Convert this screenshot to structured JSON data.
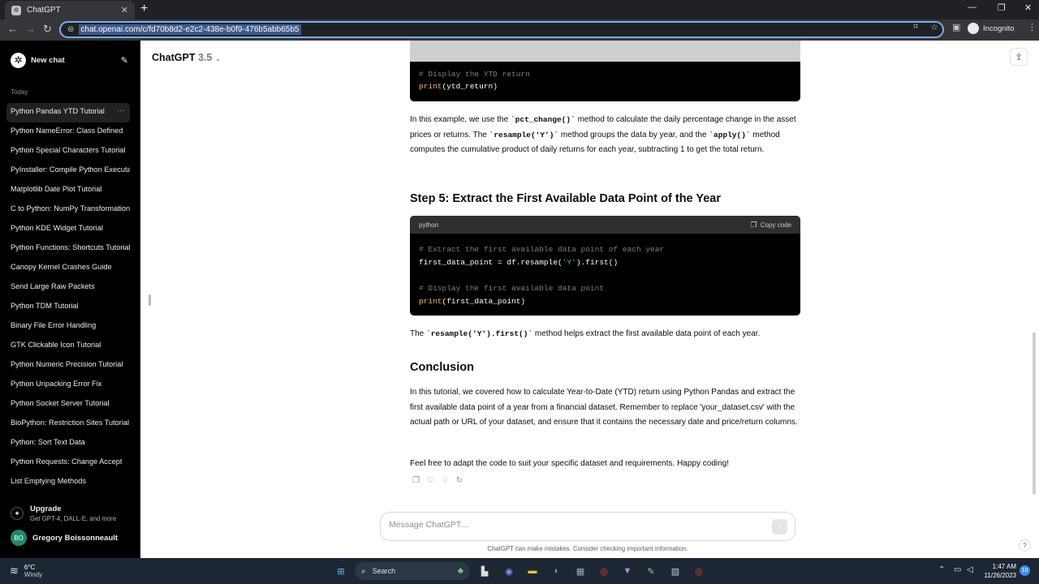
{
  "browser": {
    "tab_title": "ChatGPT",
    "url": "chat.openai.com/c/fd70b8d2-e2c2-438e-b0f9-476b5abb65b5",
    "profile_label": "Incognito"
  },
  "sidebar": {
    "new_chat": "New chat",
    "section_today": "Today",
    "items": [
      {
        "label": "Python Pandas YTD Tutorial",
        "active": true
      },
      {
        "label": "Python NameError: Class Defined"
      },
      {
        "label": "Python Special Characters Tutorial"
      },
      {
        "label": "PyInstaller: Compile Python Executable"
      },
      {
        "label": "Matplotlib Date Plot Tutorial"
      },
      {
        "label": "C to Python: NumPy Transformation"
      },
      {
        "label": "Python KDE Widget Tutorial"
      },
      {
        "label": "Python Functions: Shortcuts Tutorial"
      },
      {
        "label": "Canopy Kernel Crashes Guide"
      },
      {
        "label": "Send Large Raw Packets"
      },
      {
        "label": "Python TDM Tutorial"
      },
      {
        "label": "Binary File Error Handling"
      },
      {
        "label": "GTK Clickable Icon Tutorial"
      },
      {
        "label": "Python Numeric Precision Tutorial"
      },
      {
        "label": "Python Unpacking Error Fix"
      },
      {
        "label": "Python Socket Server Tutorial"
      },
      {
        "label": "BioPython: Restriction Sites Tutorial"
      },
      {
        "label": "Python: Sort Text Data"
      },
      {
        "label": "Python Requests: Change Accept"
      },
      {
        "label": "List Emptying Methods"
      }
    ],
    "upgrade_title": "Upgrade",
    "upgrade_sub": "Get GPT-4, DALL·E, and more",
    "user_initials": "BO",
    "user_name": "Gregory Boissonneault"
  },
  "header": {
    "model": "ChatGPT",
    "version": "3.5"
  },
  "content": {
    "top_code": {
      "comment": "# Display the YTD return",
      "print_kw": "print",
      "print_arg": "(ytd_return)"
    },
    "para1": {
      "t1": "In this example, we use the ",
      "c1": "`pct_change()`",
      "t2": " method to calculate the daily percentage change in the asset prices or returns. The ",
      "c2": "`resample('Y')`",
      "t3": " method groups the data by year, and the ",
      "c3": "`apply()`",
      "t4": " method computes the cumulative product of daily returns for each year, subtracting 1 to get the total return."
    },
    "step5_heading": "Step 5: Extract the First Available Data Point of the Year",
    "code": {
      "language": "python",
      "copy_label": "Copy code",
      "line1": "# Extract the first available data point of each year",
      "line2_a": "first_data_point = df.resample(",
      "line2_str": "'Y'",
      "line2_b": ").first()",
      "line4": "# Display the first available data point",
      "line5_kw": "print",
      "line5_arg": "(first_data_point)"
    },
    "para2": {
      "t1": "The ",
      "c1": "`resample('Y').first()`",
      "t2": " method helps extract the first available data point of each year."
    },
    "conclusion_heading": "Conclusion",
    "para3": "In this tutorial, we covered how to calculate Year-to-Date (YTD) return using Python Pandas and extract the first available data point of a year from a financial dataset. Remember to replace 'your_dataset.csv' with the actual path or URL of your dataset, and ensure that it contains the necessary date and price/return columns.",
    "para4": "Feel free to adapt the code to suit your specific dataset and requirements. Happy coding!"
  },
  "composer": {
    "placeholder": "Message ChatGPT…",
    "disclaimer": "ChatGPT can make mistakes. Consider checking important information.",
    "help": "?"
  },
  "taskbar": {
    "temp": "6°C",
    "condition": "Windy",
    "search_label": "Search",
    "time": "1:47 AM",
    "date": "11/26/2023",
    "notifications": "10"
  }
}
